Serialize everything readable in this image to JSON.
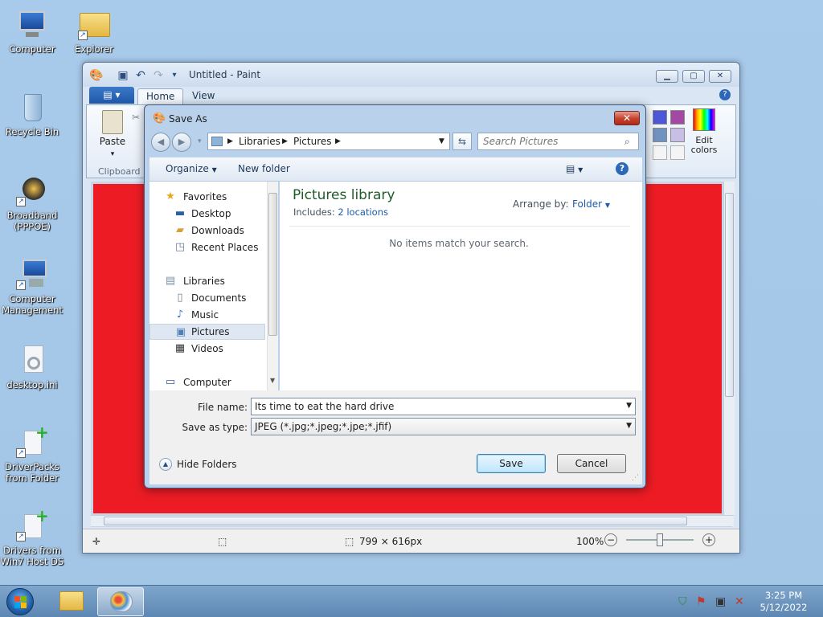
{
  "desktop": {
    "icons": [
      {
        "label": "Computer"
      },
      {
        "label": "Explorer"
      },
      {
        "label": "Recycle Bin"
      },
      {
        "label": "Broadband (PPPOE)"
      },
      {
        "label": "Computer Management"
      },
      {
        "label": "desktop.ini"
      },
      {
        "label": "DriverPacks from Folder"
      },
      {
        "label": "Drivers from Win7 Host DS"
      }
    ]
  },
  "paint": {
    "title": "Untitled - Paint",
    "tabs": {
      "file": "",
      "home": "Home",
      "view": "View"
    },
    "ribbon": {
      "paste": "Paste",
      "clipboard": "Clipboard",
      "edit_colors": "Edit colors"
    },
    "canvas_color": "#ed1c24",
    "status": {
      "dimensions": "799 × 616px",
      "zoom": "100%"
    }
  },
  "dialog": {
    "title": "Save As",
    "breadcrumb": [
      "Libraries",
      "Pictures"
    ],
    "search_placeholder": "Search Pictures",
    "toolbar": {
      "organize": "Organize",
      "new_folder": "New folder"
    },
    "nav": {
      "favorites": "Favorites",
      "desktop": "Desktop",
      "downloads": "Downloads",
      "recent": "Recent Places",
      "libraries": "Libraries",
      "documents": "Documents",
      "music": "Music",
      "pictures": "Pictures",
      "videos": "Videos",
      "computer": "Computer"
    },
    "library": {
      "title": "Pictures library",
      "includes_label": "Includes:",
      "locations": "2 locations",
      "arrange_label": "Arrange by:",
      "arrange_value": "Folder",
      "empty_message": "No items match your search."
    },
    "form": {
      "file_name_label": "File name:",
      "file_name": "Its time to eat the hard drive",
      "type_label": "Save as type:",
      "type_value": "JPEG (*.jpg;*.jpeg;*.jpe;*.jfif)"
    },
    "hide_folders": "Hide Folders",
    "save": "Save",
    "cancel": "Cancel"
  },
  "taskbar": {
    "time": "3:25 PM",
    "date": "5/12/2022"
  }
}
